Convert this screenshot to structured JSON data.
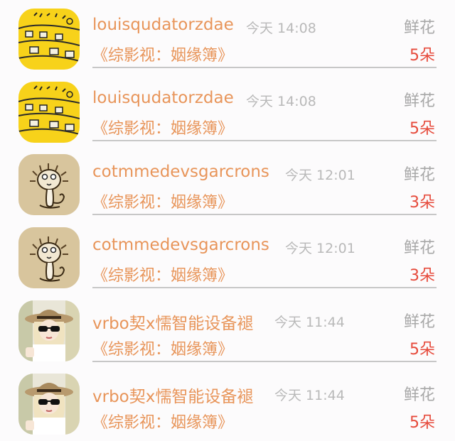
{
  "messages": [
    {
      "username": "louisqudatorzdae",
      "time": "今天 14:08",
      "gift_label": "鲜花",
      "show": "《综影视：姻缘簿》",
      "count": "5朵",
      "avatar": "yellow-cartoon-avatar"
    },
    {
      "username": "louisqudatorzdae",
      "time": "今天 14:08",
      "gift_label": "鲜花",
      "show": "《综影视：姻缘簿》",
      "count": "5朵",
      "avatar": "yellow-cartoon-avatar"
    },
    {
      "username": "cotmmedevsgarcrons",
      "time": "今天 12:01",
      "gift_label": "鲜花",
      "show": "《综影视：姻缘簿》",
      "count": "3朵",
      "avatar": "lion-sketch-avatar"
    },
    {
      "username": "cotmmedevsgarcrons",
      "time": "今天 12:01",
      "gift_label": "鲜花",
      "show": "《综影视：姻缘簿》",
      "count": "3朵",
      "avatar": "lion-sketch-avatar"
    },
    {
      "username": "vrbo契x懦智能设备褪",
      "time": "今天 11:44",
      "gift_label": "鲜花",
      "show": "《综影视：姻缘簿》",
      "count": "5朵",
      "avatar": "girl-hat-avatar"
    },
    {
      "username": "vrbo契x懦智能设备褪",
      "time": "今天 11:44",
      "gift_label": "鲜花",
      "show": "《综影视：姻缘簿》",
      "count": "5朵",
      "avatar": "girl-hat-avatar"
    }
  ],
  "colors": {
    "name": "#e8955a",
    "show": "#e8955a",
    "count": "#e64a3b",
    "time": "#b9b9b9",
    "gift": "#a8a8a8",
    "divider": "#c7c7c7",
    "background": "#fcfbfc"
  }
}
